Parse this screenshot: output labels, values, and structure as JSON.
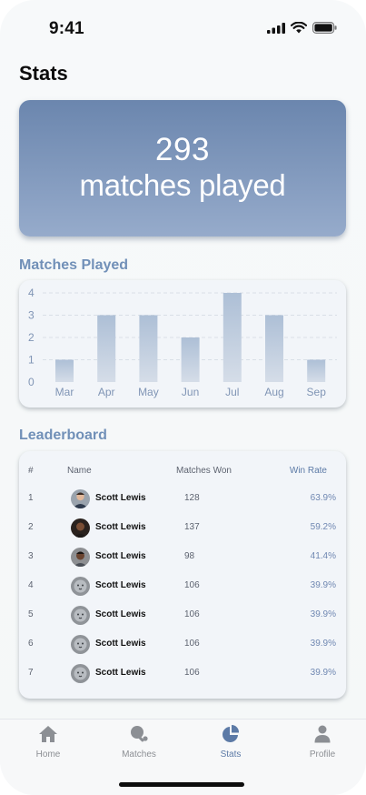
{
  "status_bar": {
    "time": "9:41"
  },
  "page": {
    "title": "Stats"
  },
  "hero": {
    "number": "293",
    "label": "matches played"
  },
  "chart_section": {
    "title": "Matches Played"
  },
  "chart_data": {
    "type": "bar",
    "categories": [
      "Mar",
      "Apr",
      "May",
      "Jun",
      "Jul",
      "Aug",
      "Sep"
    ],
    "values": [
      1,
      3,
      3,
      2,
      4,
      3,
      1
    ],
    "y_ticks": [
      "0",
      "1",
      "2",
      "3",
      "4"
    ],
    "ylim": [
      0,
      4
    ],
    "grid": true,
    "colors": {
      "bar_top": "#adbfd6",
      "bar_bottom": "#d5dde8",
      "label": "#8095b5"
    }
  },
  "leaderboard": {
    "title": "Leaderboard",
    "columns": {
      "rank": "#",
      "name": "Name",
      "won": "Matches Won",
      "rate": "Win Rate"
    },
    "rows": [
      {
        "rank": "1",
        "name": "Scott Lewis",
        "won": "128",
        "rate": "63.9%"
      },
      {
        "rank": "2",
        "name": "Scott Lewis",
        "won": "137",
        "rate": "59.2%"
      },
      {
        "rank": "3",
        "name": "Scott Lewis",
        "won": "98",
        "rate": "41.4%"
      },
      {
        "rank": "4",
        "name": "Scott Lewis",
        "won": "106",
        "rate": "39.9%"
      },
      {
        "rank": "5",
        "name": "Scott Lewis",
        "won": "106",
        "rate": "39.9%"
      },
      {
        "rank": "6",
        "name": "Scott Lewis",
        "won": "106",
        "rate": "39.9%"
      },
      {
        "rank": "7",
        "name": "Scott Lewis",
        "won": "106",
        "rate": "39.9%"
      }
    ]
  },
  "tabs": [
    {
      "label": "Home",
      "icon": "home-icon",
      "active": false
    },
    {
      "label": "Matches",
      "icon": "ping-pong-icon",
      "active": false
    },
    {
      "label": "Stats",
      "icon": "pie-chart-icon",
      "active": true
    },
    {
      "label": "Profile",
      "icon": "person-icon",
      "active": false
    }
  ],
  "colors": {
    "accent": "#5c7aa6",
    "hero_top": "#6b86ae",
    "hero_bottom": "#96abcb",
    "section_title": "#7190b8"
  }
}
